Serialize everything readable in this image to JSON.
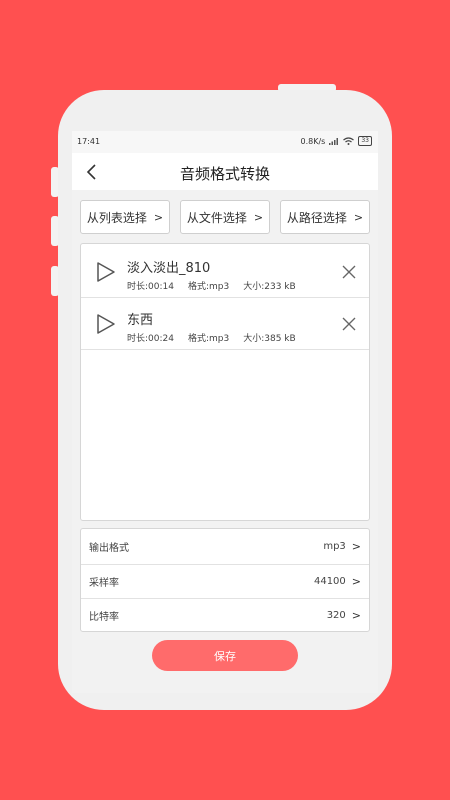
{
  "status": {
    "time": "17:41",
    "network": "0.8K/s",
    "battery": "33"
  },
  "header": {
    "title": "音频格式转换"
  },
  "sources": [
    {
      "label": "从列表选择"
    },
    {
      "label": "从文件选择"
    },
    {
      "label": "从路径选择"
    }
  ],
  "files": [
    {
      "name": "淡入淡出_810",
      "duration": "时长:00:14",
      "format": "格式:mp3",
      "size": "大小:233 kB"
    },
    {
      "name": "东西",
      "duration": "时长:00:24",
      "format": "格式:mp3",
      "size": "大小:385 kB"
    }
  ],
  "settings": [
    {
      "label": "输出格式",
      "value": "mp3"
    },
    {
      "label": "采样率",
      "value": "44100"
    },
    {
      "label": "比特率",
      "value": "320"
    }
  ],
  "save_label": "保存",
  "colors": {
    "background": "#ff5050",
    "save_button": "#ff6b6b"
  },
  "icons": [
    "back-icon",
    "play-icon",
    "close-icon",
    "chevron-right-icon",
    "wifi-icon",
    "signal-icon",
    "battery-icon"
  ]
}
